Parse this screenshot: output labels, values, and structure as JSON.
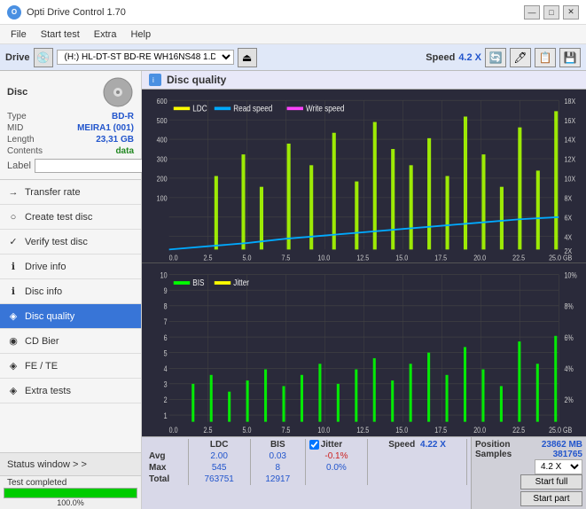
{
  "app": {
    "title": "Opti Drive Control 1.70",
    "logo": "O"
  },
  "titlebar": {
    "minimize": "—",
    "maximize": "□",
    "close": "✕"
  },
  "menubar": {
    "items": [
      "File",
      "Start test",
      "Extra",
      "Help"
    ]
  },
  "drive_bar": {
    "label": "Drive",
    "drive_name": "(H:)  HL-DT-ST BD-RE  WH16NS48 1.D3",
    "speed_label": "Speed",
    "speed_value": "4.2 X"
  },
  "disc": {
    "title": "Disc",
    "type_label": "Type",
    "type_value": "BD-R",
    "mid_label": "MID",
    "mid_value": "MEIRA1 (001)",
    "length_label": "Length",
    "length_value": "23,31 GB",
    "contents_label": "Contents",
    "contents_value": "data",
    "label_label": "Label",
    "label_value": ""
  },
  "nav_items": [
    {
      "id": "transfer-rate",
      "label": "Transfer rate",
      "icon": "→"
    },
    {
      "id": "create-test-disc",
      "label": "Create test disc",
      "icon": "💿"
    },
    {
      "id": "verify-test-disc",
      "label": "Verify test disc",
      "icon": "✓"
    },
    {
      "id": "drive-info",
      "label": "Drive info",
      "icon": "ℹ"
    },
    {
      "id": "disc-info",
      "label": "Disc info",
      "icon": "ℹ"
    },
    {
      "id": "disc-quality",
      "label": "Disc quality",
      "icon": "◈",
      "active": true
    },
    {
      "id": "cd-bier",
      "label": "CD Bier",
      "icon": "◉"
    },
    {
      "id": "fe-te",
      "label": "FE / TE",
      "icon": "◈"
    },
    {
      "id": "extra-tests",
      "label": "Extra tests",
      "icon": "◈"
    }
  ],
  "status_window": {
    "label": "Status window > >"
  },
  "progress": {
    "value": 100,
    "text": "100.0%",
    "status": "Test completed"
  },
  "quality_panel": {
    "title": "Disc quality"
  },
  "chart1": {
    "legend": [
      {
        "label": "LDC",
        "color": "#ffff00"
      },
      {
        "label": "Read speed",
        "color": "#00aaff"
      },
      {
        "label": "Write speed",
        "color": "#ff44ff"
      }
    ],
    "y_max": 600,
    "y_right_labels": [
      "18X",
      "16X",
      "14X",
      "12X",
      "10X",
      "8X",
      "6X",
      "4X",
      "2X"
    ],
    "x_labels": [
      "0.0",
      "2.5",
      "5.0",
      "7.5",
      "10.0",
      "12.5",
      "15.0",
      "17.5",
      "20.0",
      "22.5",
      "25.0 GB"
    ]
  },
  "chart2": {
    "legend": [
      {
        "label": "BIS",
        "color": "#00ff00"
      },
      {
        "label": "Jitter",
        "color": "#ffff00"
      }
    ],
    "y_left_labels": [
      "10",
      "9",
      "8",
      "7",
      "6",
      "5",
      "4",
      "3",
      "2",
      "1"
    ],
    "y_right_labels": [
      "10%",
      "8%",
      "6%",
      "4%",
      "2%"
    ],
    "x_labels": [
      "0.0",
      "2.5",
      "5.0",
      "7.5",
      "10.0",
      "12.5",
      "15.0",
      "17.5",
      "20.0",
      "22.5",
      "25.0 GB"
    ]
  },
  "stats": {
    "headers": [
      "LDC",
      "BIS",
      "",
      "Jitter",
      "Speed",
      "4.22 X"
    ],
    "jitter_checked": true,
    "rows": [
      {
        "label": "Avg",
        "ldc": "2.00",
        "bis": "0.03",
        "jitter": "-0.1%"
      },
      {
        "label": "Max",
        "ldc": "545",
        "bis": "8",
        "jitter": "0.0%"
      },
      {
        "label": "Total",
        "ldc": "763751",
        "bis": "12917",
        "jitter": ""
      }
    ],
    "position_label": "Position",
    "position_value": "23862 MB",
    "samples_label": "Samples",
    "samples_value": "381765",
    "speed_dropdown": "4.2 X",
    "start_full_label": "Start full",
    "start_part_label": "Start part",
    "jitter_label": "Jitter",
    "speed_label": "Speed",
    "speed_value": "4.22 X"
  }
}
